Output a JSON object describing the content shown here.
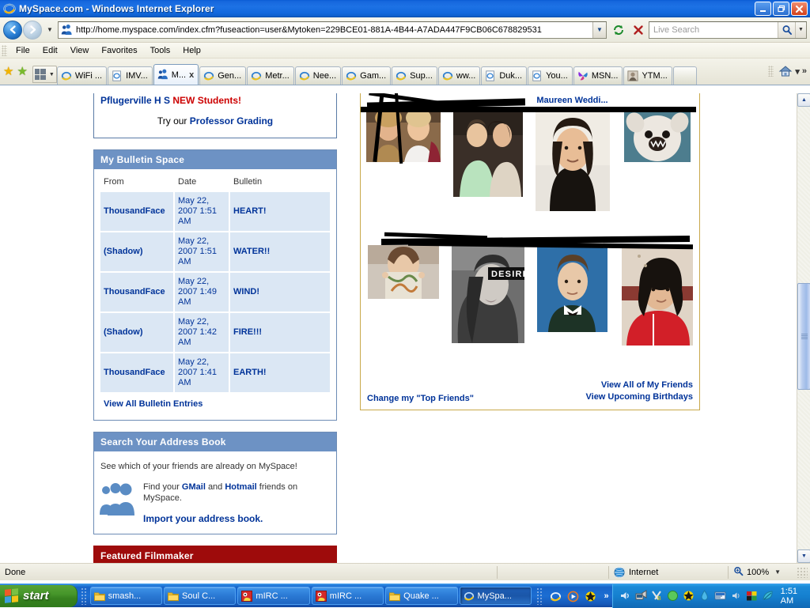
{
  "window": {
    "title": "MySpace.com - Windows Internet Explorer",
    "minimize_label": "Minimize",
    "maximize_label": "Maximize",
    "close_label": "Close"
  },
  "address_bar": {
    "url": "http://home.myspace.com/index.cfm?fuseaction=user&Mytoken=229BCE01-881A-4B44-A7ADA447F9CB06C678829531",
    "refresh_label": "Refresh",
    "stop_label": "Stop"
  },
  "search": {
    "placeholder": "Live Search",
    "value": ""
  },
  "menu": {
    "items": [
      "File",
      "Edit",
      "View",
      "Favorites",
      "Tools",
      "Help"
    ]
  },
  "tabs": {
    "items": [
      {
        "label": "WiFi ...",
        "icon": "ie-icon",
        "active": false
      },
      {
        "label": "IMV...",
        "icon": "page-icon",
        "active": false
      },
      {
        "label": "M...",
        "icon": "myspace-icon",
        "active": true,
        "close_label": "x"
      },
      {
        "label": "Gen...",
        "icon": "ie-icon",
        "active": false
      },
      {
        "label": "Metr...",
        "icon": "ie-icon",
        "active": false
      },
      {
        "label": "Nee...",
        "icon": "ie-icon",
        "active": false
      },
      {
        "label": "Gam...",
        "icon": "ie-icon",
        "active": false
      },
      {
        "label": "Sup...",
        "icon": "ie-icon",
        "active": false
      },
      {
        "label": "ww...",
        "icon": "ie-icon",
        "active": false
      },
      {
        "label": "Duk...",
        "icon": "page-icon",
        "active": false
      },
      {
        "label": "You...",
        "icon": "page-icon",
        "active": false
      },
      {
        "label": "MSN...",
        "icon": "msn-icon",
        "active": false
      },
      {
        "label": "YTM...",
        "icon": "photo-icon",
        "active": false
      }
    ],
    "overflow_label": "»"
  },
  "school_promo": {
    "name": "Pflugerville H S",
    "new": "NEW",
    "students": "Students!",
    "try_our": "Try our",
    "link": "Professor Grading"
  },
  "bulletin_panel": {
    "title": "My Bulletin Space",
    "columns": [
      "From",
      "Date",
      "Bulletin"
    ],
    "rows": [
      {
        "from": "ThousandFace",
        "date": "May 22, 2007 1:51 AM",
        "subject": "HEART!"
      },
      {
        "from": "(Shadow)",
        "date": "May 22, 2007 1:51 AM",
        "subject": "WATER!!"
      },
      {
        "from": "ThousandFace",
        "date": "May 22, 2007 1:49 AM",
        "subject": "WIND!"
      },
      {
        "from": "(Shadow)",
        "date": "May 22, 2007 1:42 AM",
        "subject": "FIRE!!!"
      },
      {
        "from": "ThousandFace",
        "date": "May 22, 2007 1:41 AM",
        "subject": "EARTH!"
      }
    ],
    "view_all": "View All Bulletin Entries"
  },
  "address_book_panel": {
    "title": "Search Your Address Book",
    "intro": "See which of your friends are already on MySpace!",
    "find_prefix": "Find your",
    "gmail": "GMail",
    "and": "and",
    "hotmail": "Hotmail",
    "find_suffix": "friends on MySpace.",
    "import_link": "Import your address book."
  },
  "featured_panel": {
    "title": "Featured Filmmaker"
  },
  "friends_panel": {
    "row1_names": [
      "",
      "",
      "Maureen Weddi...",
      ""
    ],
    "row2_names": [
      "",
      "",
      "",
      ""
    ],
    "change_top_friends": "Change my \"Top Friends\"",
    "view_all_friends": "View All of My Friends",
    "view_birthdays": "View Upcoming Birthdays",
    "photo_badge": "DESIRE"
  },
  "status_bar": {
    "status": "Done",
    "zone": "Internet",
    "zoom": "100%"
  },
  "taskbar": {
    "start": "start",
    "items": [
      {
        "label": "smash...",
        "icon": "folder-icon",
        "active": false
      },
      {
        "label": "Soul C...",
        "icon": "folder-icon",
        "active": false
      },
      {
        "label": "mIRC ...",
        "icon": "mirc-icon",
        "active": false
      },
      {
        "label": "mIRC ...",
        "icon": "mirc-icon",
        "active": false
      },
      {
        "label": "Quake ...",
        "icon": "folder-icon",
        "active": false
      },
      {
        "label": "MySpa...",
        "icon": "ie-icon",
        "active": true
      }
    ],
    "clock": "1:51 AM",
    "overflow": "»"
  },
  "colors": {
    "title_blue": "#1d72e5",
    "panel_header_blue": "#6d92c4",
    "panel_header_red": "#9e0b0b",
    "link_navy": "#003399",
    "row_blue": "#dbe7f4",
    "accent_red": "#cc0000",
    "friends_border_gold": "#c8a84a"
  }
}
